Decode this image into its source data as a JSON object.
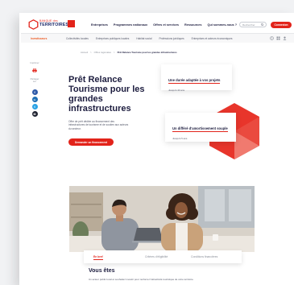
{
  "colors": {
    "brand_red": "#e2231a",
    "navy": "#1d1d3f",
    "accent_orange": "#ec5b24",
    "share_facebook": "#2f5aa8",
    "share_linkedin": "#1f6fb5",
    "share_twitter": "#2aa3e6"
  },
  "header": {
    "logo": {
      "line1": "BANQUE des",
      "line2": "TERRITOIRES",
      "icon": "hexagon-logo-icon"
    },
    "nav": [
      "Entreprises",
      "Programmes nationaux",
      "Offres et services",
      "Ressources",
      "Qui sommes-nous ?"
    ],
    "search": {
      "placeholder": "Rechercher",
      "icon": "search-icon"
    },
    "login_label": "Connexion"
  },
  "audience_bar": {
    "active": "Investisseurs",
    "items": [
      "Collectivités locales",
      "Entreprises publiques locales",
      "Habitat social",
      "Professions juridiques",
      "Entreprises et acteurs économiques"
    ],
    "icons": [
      "help-icon",
      "grid-icon",
      "user-icon"
    ]
  },
  "breadcrumb": {
    "separator": ">",
    "items": [
      "Accueil",
      "Offres régionales",
      "Prêt Relance Tourisme pour les grandes infrastructures"
    ]
  },
  "sidebar": {
    "print_label": "Imprimer",
    "share_label": "Partager sur",
    "share_icons": [
      "facebook-icon",
      "linkedin-icon",
      "twitter-icon",
      "email-icon"
    ]
  },
  "hero": {
    "title": "Prêt Relance Tourisme pour les grandes infrastructures",
    "description": "Offre de prêt dédiée au financement des infrastructures de tourisme et de soutien aux acteurs du secteur.",
    "cta": "Demander un financement"
  },
  "highlights": [
    {
      "title": "Une durée adaptée à vos projets",
      "value": "Jusqu'à 40 ans"
    },
    {
      "title": "Un différé d'amortissement souple",
      "value": "Jusqu'à 5 ans"
    }
  ],
  "tabs": {
    "items": [
      "En bref",
      "Critères d'éligibilité",
      "Conditions financières"
    ],
    "active_index": 0
  },
  "section": {
    "heading": "Vous êtes",
    "text": "Un acteur public local et souhaitez investir pour renforcer l'attractivité touristique de votre territoire."
  }
}
